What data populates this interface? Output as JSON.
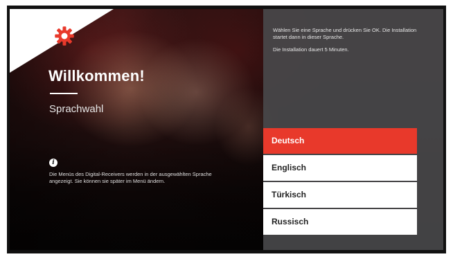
{
  "welcome": {
    "title": "Willkommen!",
    "subtitle": "Sprachwahl"
  },
  "info": {
    "icon": "info-icon",
    "text": "Die Menüs des Digital-Receivers werden in der ausgewählten Sprache angezeigt. Sie können sie später im Menü ändern."
  },
  "panel": {
    "instruction": "Wählen Sie eine Sprache und drücken Sie OK. Die Installation startet dann in dieser Sprache.",
    "duration": "Die Installation dauert 5 Minuten."
  },
  "languages": {
    "items": [
      {
        "label": "Deutsch",
        "selected": true
      },
      {
        "label": "Englisch",
        "selected": false
      },
      {
        "label": "Türkisch",
        "selected": false
      },
      {
        "label": "Russisch",
        "selected": false
      }
    ]
  },
  "colors": {
    "accent": "#e8392b",
    "panel": "#464648",
    "frame": "#111111"
  },
  "icons": {
    "settings": "gear-icon"
  }
}
